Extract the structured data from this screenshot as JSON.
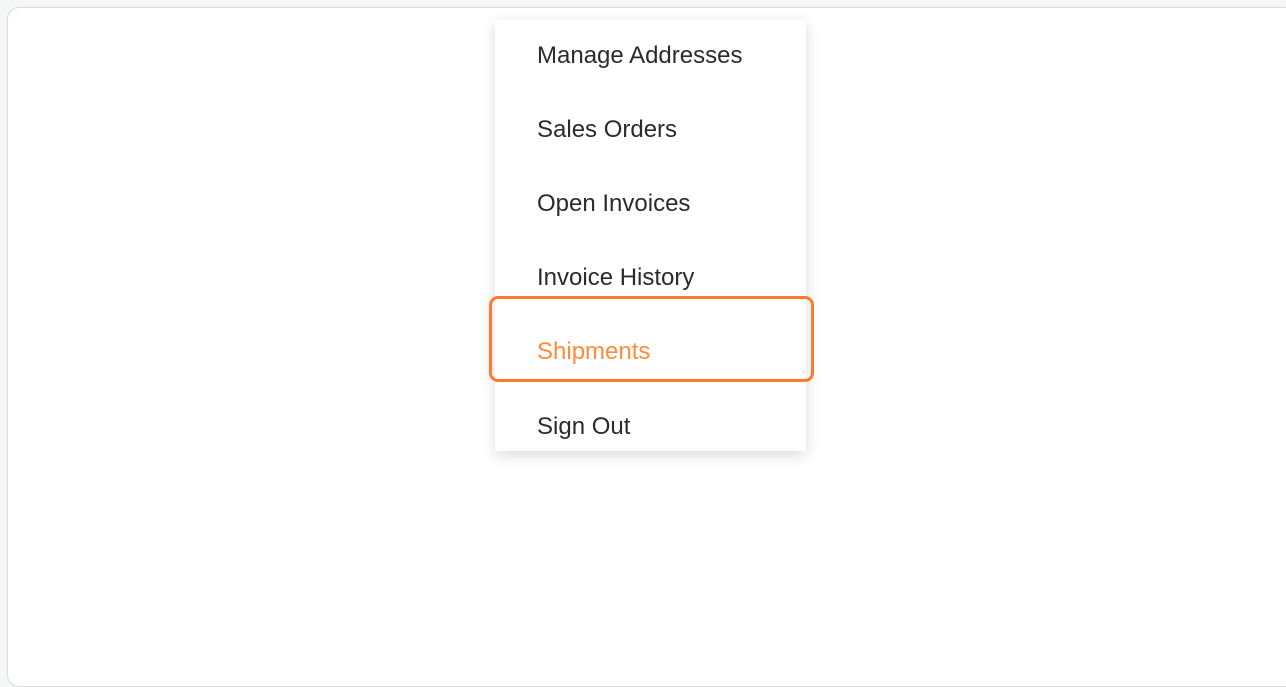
{
  "menu": {
    "items": [
      {
        "label": "Manage Addresses",
        "highlighted": false
      },
      {
        "label": "Sales Orders",
        "highlighted": false
      },
      {
        "label": "Open Invoices",
        "highlighted": false
      },
      {
        "label": "Invoice History",
        "highlighted": false
      },
      {
        "label": "Shipments",
        "highlighted": true
      },
      {
        "label": "Sign Out",
        "highlighted": false
      }
    ]
  },
  "colors": {
    "highlight_text": "#ff8c3a",
    "highlight_border": "#ff7a2a",
    "text": "#2b2b2b"
  }
}
